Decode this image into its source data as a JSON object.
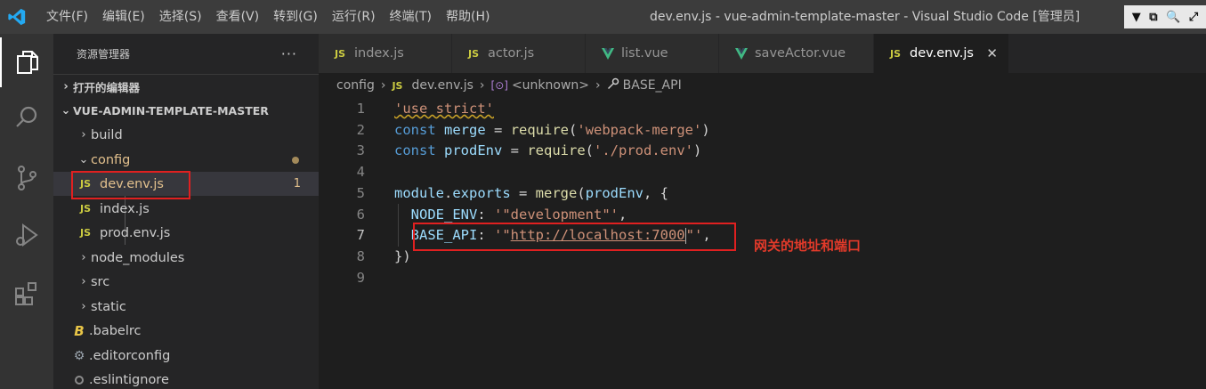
{
  "titlebar": {
    "menu": [
      "文件(F)",
      "编辑(E)",
      "选择(S)",
      "查看(V)",
      "转到(G)",
      "运行(R)",
      "终端(T)",
      "帮助(H)"
    ],
    "title": "dev.env.js - vue-admin-template-master - Visual Studio Code [管理员]",
    "controls": [
      "▼",
      "⧉",
      "🔍",
      "⤢"
    ]
  },
  "activitybar": {
    "icons": [
      "explorer-icon",
      "search-icon",
      "source-control-icon",
      "run-debug-icon",
      "extensions-icon"
    ]
  },
  "sidebar": {
    "title": "资源管理器",
    "more": "···",
    "open_editors": "打开的编辑器",
    "project": "VUE-ADMIN-TEMPLATE-MASTER",
    "items": [
      {
        "label": "build",
        "kind": "folder",
        "expanded": false
      },
      {
        "label": "config",
        "kind": "folder",
        "expanded": true,
        "modified": true
      },
      {
        "label": "dev.env.js",
        "kind": "js",
        "selected": true,
        "badge": "1"
      },
      {
        "label": "index.js",
        "kind": "js"
      },
      {
        "label": "prod.env.js",
        "kind": "js"
      },
      {
        "label": "node_modules",
        "kind": "folder",
        "expanded": false
      },
      {
        "label": "src",
        "kind": "folder",
        "expanded": false
      },
      {
        "label": "static",
        "kind": "folder",
        "expanded": false
      },
      {
        "label": ".babelrc",
        "kind": "babel"
      },
      {
        "label": ".editorconfig",
        "kind": "gear"
      },
      {
        "label": ".eslintignore",
        "kind": "eslint"
      }
    ],
    "js_icon_text": "JS"
  },
  "tabs": [
    {
      "label": "index.js",
      "kind": "js"
    },
    {
      "label": "actor.js",
      "kind": "js"
    },
    {
      "label": "list.vue",
      "kind": "vue"
    },
    {
      "label": "saveActor.vue",
      "kind": "vue"
    },
    {
      "label": "dev.env.js",
      "kind": "js",
      "active": true,
      "close": "✕"
    }
  ],
  "breadcrumb": {
    "folder": "config",
    "file": "dev.env.js",
    "symbol1": "<unknown>",
    "symbol2": "BASE_API"
  },
  "editor": {
    "line_numbers": [
      "1",
      "2",
      "3",
      "4",
      "5",
      "6",
      "7",
      "8",
      "9"
    ],
    "active_line": 7,
    "annotation": "网关的地址和端口"
  },
  "colors": {
    "accent_red": "#e02020",
    "keyword": "#569cd6",
    "string": "#ce9178",
    "variable": "#9cdcfe",
    "function": "#dcdcaa"
  }
}
